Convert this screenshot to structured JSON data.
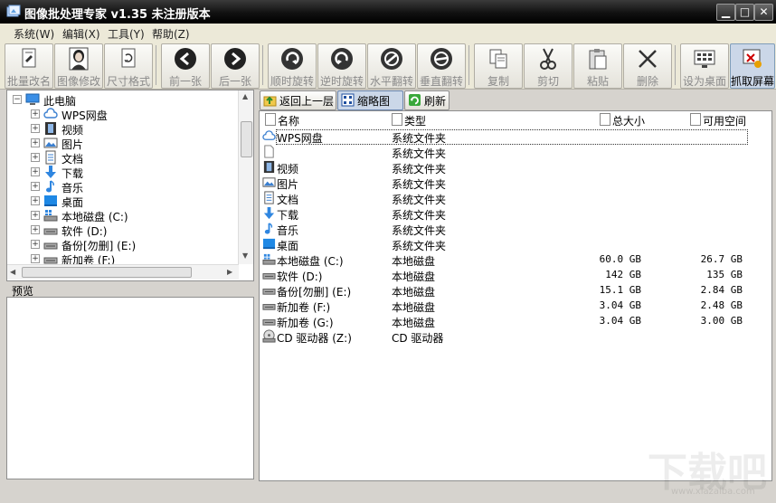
{
  "window": {
    "title": "图像批处理专家 v1.35 未注册版本",
    "controls": [
      "▁",
      "□",
      "✕"
    ]
  },
  "menu": [
    {
      "label": "系统(W)"
    },
    {
      "label": "编辑(X)"
    },
    {
      "label": "工具(Y)"
    },
    {
      "label": "帮助(Z)"
    }
  ],
  "toolbar": [
    {
      "label": "批量改名",
      "icon": "rename-icon"
    },
    {
      "label": "图像修改",
      "icon": "portrait-icon"
    },
    {
      "label": "尺寸格式",
      "icon": "resize-icon"
    },
    {
      "label": "前一张",
      "icon": "prev-arrow-icon"
    },
    {
      "label": "后一张",
      "icon": "next-arrow-icon"
    },
    {
      "label": "顺时旋转",
      "icon": "rotate-cw-icon"
    },
    {
      "label": "逆时旋转",
      "icon": "rotate-ccw-icon"
    },
    {
      "label": "水平翻转",
      "icon": "flip-horizontal-icon"
    },
    {
      "label": "垂直翻转",
      "icon": "flip-vertical-icon"
    },
    {
      "label": "复制",
      "icon": "copy-icon"
    },
    {
      "label": "剪切",
      "icon": "scissors-icon"
    },
    {
      "label": "粘贴",
      "icon": "paste-icon"
    },
    {
      "label": "删除",
      "icon": "delete-x-icon"
    },
    {
      "label": "设为桌面",
      "icon": "set-desktop-icon"
    },
    {
      "label": "抓取屏幕",
      "icon": "capture-screen-icon"
    }
  ],
  "tree": {
    "root": "此电脑",
    "items": [
      {
        "label": "WPS网盘",
        "icon": "cloud-icon"
      },
      {
        "label": "视频",
        "icon": "video-icon"
      },
      {
        "label": "图片",
        "icon": "picture-icon"
      },
      {
        "label": "文档",
        "icon": "document-icon"
      },
      {
        "label": "下载",
        "icon": "download-icon"
      },
      {
        "label": "音乐",
        "icon": "music-icon"
      },
      {
        "label": "桌面",
        "icon": "desktop-icon"
      },
      {
        "label": "本地磁盘 (C:)",
        "icon": "system-drive-icon"
      },
      {
        "label": "软件 (D:)",
        "icon": "drive-icon"
      },
      {
        "label": "备份[勿删] (E:)",
        "icon": "drive-icon"
      },
      {
        "label": "新加卷 (F:)",
        "icon": "drive-icon"
      }
    ]
  },
  "preview": {
    "label": "预览"
  },
  "nav": {
    "up_label": "返回上一层",
    "thumb_label": "缩略图",
    "refresh_label": "刷新"
  },
  "columns": {
    "name": "名称",
    "type": "类型",
    "total": "总大小",
    "free": "可用空间"
  },
  "rows": [
    {
      "name": "WPS网盘",
      "type": "系统文件夹",
      "total": "",
      "free": "",
      "icon": "cloud-icon"
    },
    {
      "name": "",
      "type": "系统文件夹",
      "total": "",
      "free": "",
      "icon": "blank-document-icon"
    },
    {
      "name": "视频",
      "type": "系统文件夹",
      "total": "",
      "free": "",
      "icon": "video-icon"
    },
    {
      "name": "图片",
      "type": "系统文件夹",
      "total": "",
      "free": "",
      "icon": "picture-icon"
    },
    {
      "name": "文档",
      "type": "系统文件夹",
      "total": "",
      "free": "",
      "icon": "document-icon"
    },
    {
      "name": "下载",
      "type": "系统文件夹",
      "total": "",
      "free": "",
      "icon": "download-icon"
    },
    {
      "name": "音乐",
      "type": "系统文件夹",
      "total": "",
      "free": "",
      "icon": "music-icon"
    },
    {
      "name": "桌面",
      "type": "系统文件夹",
      "total": "",
      "free": "",
      "icon": "desktop-icon"
    },
    {
      "name": "本地磁盘 (C:)",
      "type": "本地磁盘",
      "total": "60.0 GB",
      "free": "26.7 GB",
      "icon": "system-drive-icon"
    },
    {
      "name": "软件 (D:)",
      "type": "本地磁盘",
      "total": "142 GB",
      "free": "135 GB",
      "icon": "drive-icon"
    },
    {
      "name": "备份[勿删] (E:)",
      "type": "本地磁盘",
      "total": "15.1 GB",
      "free": "2.84 GB",
      "icon": "drive-icon"
    },
    {
      "name": "新加卷 (F:)",
      "type": "本地磁盘",
      "total": "3.04 GB",
      "free": "2.48 GB",
      "icon": "drive-icon"
    },
    {
      "name": "新加卷 (G:)",
      "type": "本地磁盘",
      "total": "3.04 GB",
      "free": "3.00 GB",
      "icon": "drive-icon"
    },
    {
      "name": "CD 驱动器 (Z:)",
      "type": "CD 驱动器",
      "total": "",
      "free": "",
      "icon": "cd-drive-icon"
    }
  ],
  "watermark": {
    "text": "下载吧",
    "sub": "www.xiazaiba.com"
  }
}
